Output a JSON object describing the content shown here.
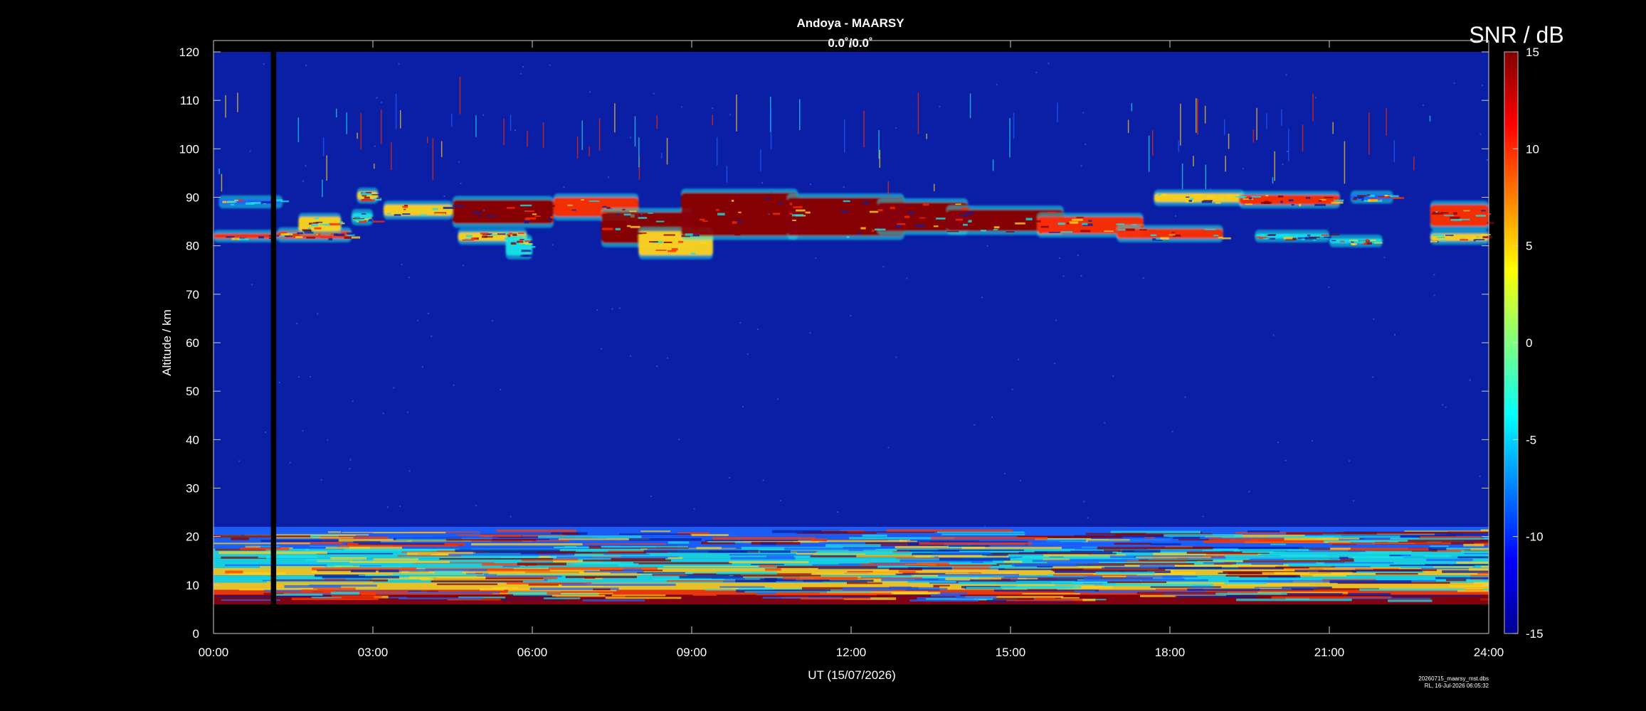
{
  "chart_data": {
    "type": "heatmap",
    "title": "Andoya - MAARSY",
    "subtitle": "0.0˚/0.0˚",
    "xlabel": "UT (15/07/2026)",
    "ylabel": "Altitude / km",
    "colorbar_label": "SNR / dB",
    "x_ticks": [
      "00:00",
      "03:00",
      "06:00",
      "09:00",
      "12:00",
      "15:00",
      "18:00",
      "21:00",
      "24:00"
    ],
    "xlim_hours": [
      0,
      24
    ],
    "y_ticks": [
      0,
      10,
      20,
      30,
      40,
      50,
      60,
      70,
      80,
      90,
      100,
      110,
      120
    ],
    "ylim": [
      0,
      120
    ],
    "colorbar_ticks": [
      15,
      10,
      5,
      0,
      -5,
      -10,
      -15
    ],
    "clim": [
      -15,
      15
    ],
    "colormap": "jet",
    "colors": {
      "background": "#000000",
      "field": "#0a1fa6",
      "weak": "#1e63ff",
      "medium": "#19e0e6",
      "strong": "#ffd21a",
      "max": "#8c0000"
    },
    "data_gap_hours": [
      1.08,
      1.18
    ],
    "data_floor_km": 6,
    "layers": [
      {
        "name_hint": "mesospheric echoes",
        "alt_range_km": [
          77,
          93
        ],
        "t_range_hours": [
          0,
          24
        ]
      },
      {
        "name_hint": "tropospheric echoes",
        "alt_range_km": [
          6,
          22
        ],
        "t_range_hours": [
          0,
          24
        ]
      }
    ],
    "footer": [
      "20260715_maarsy_mst.dbs",
      "RL, 16-Jul-2026 06:05:32"
    ]
  }
}
